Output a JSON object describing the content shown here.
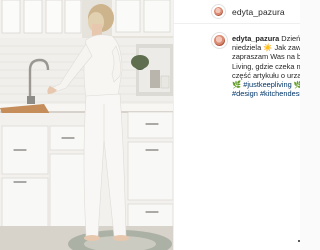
{
  "post": {
    "username": "edyta_pazura",
    "caption_lines": [
      {
        "user": "edyta_pazura",
        "text": " Dzień d"
      },
      {
        "text": "niedziela ☀️ Jak zawsze"
      },
      {
        "text": "zapraszam Was na blog"
      },
      {
        "text": "Living, gdzie czeka na W"
      },
      {
        "text": "część artykułu o urządz"
      },
      {
        "emoji": "🌿",
        "tag": " #justkeepliving",
        "emoji2": " 🌿"
      },
      {
        "tag": "#design #kitchendesign"
      }
    ]
  },
  "colors": {
    "text": "#262626",
    "hashtag": "#003569",
    "border": "#efefef",
    "cabinet": "#f4f3f0",
    "clothing": "#f7f6f3"
  }
}
